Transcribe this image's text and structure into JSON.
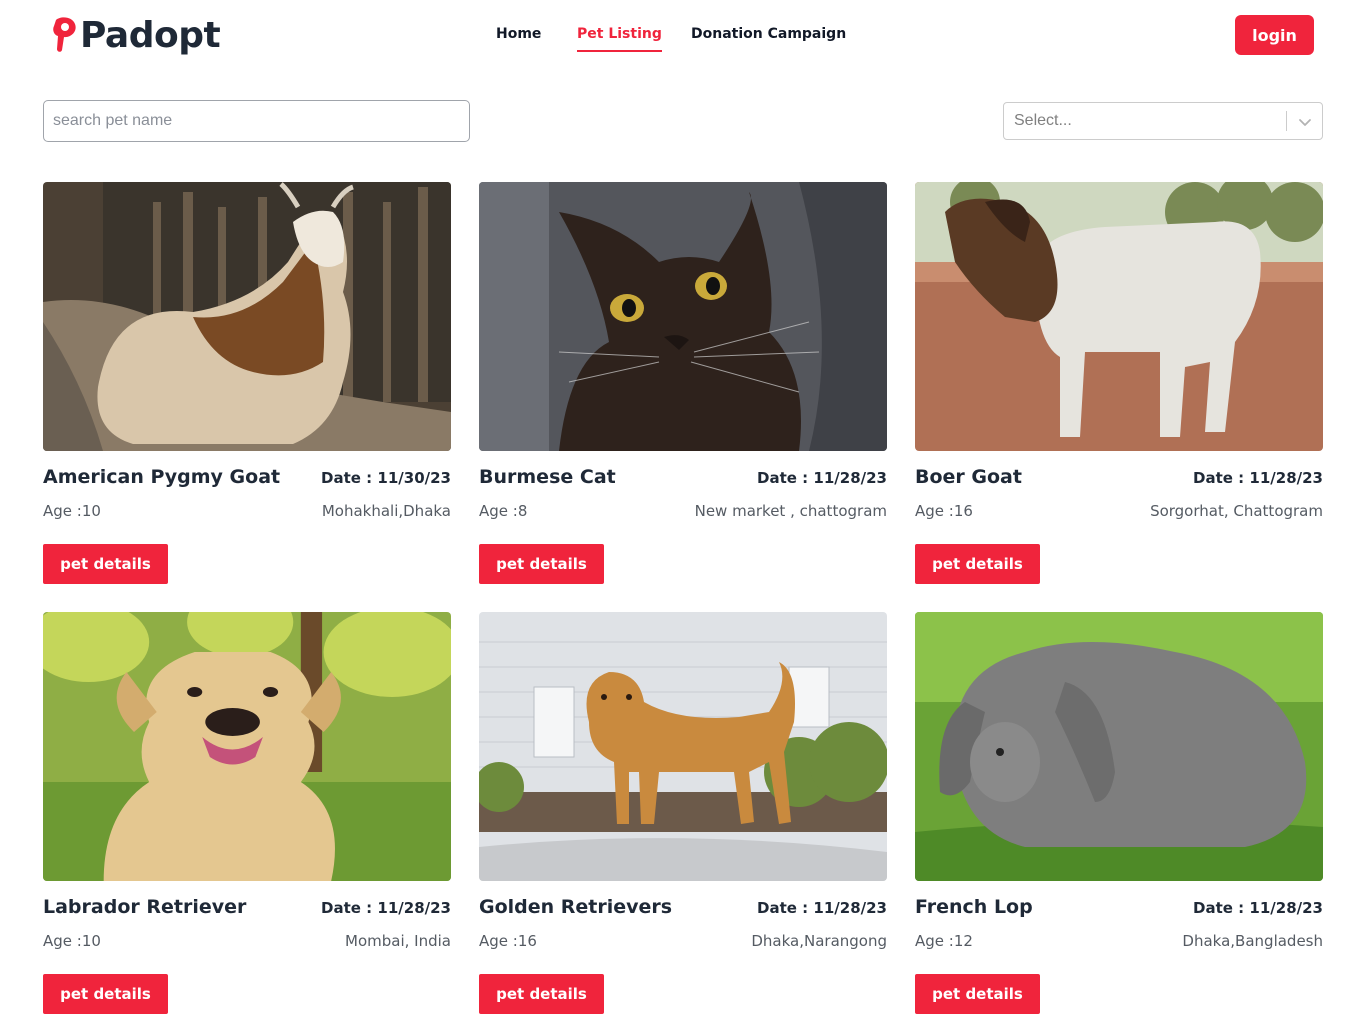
{
  "brand": {
    "name": "Padopt",
    "logo_icon": "paw-logo-icon",
    "accent": "#f0243c"
  },
  "nav": {
    "items": [
      {
        "label": "Home",
        "active": false
      },
      {
        "label": "Pet Listing",
        "active": true
      },
      {
        "label": "Donation Campaign",
        "active": false
      }
    ],
    "login_label": "login"
  },
  "filters": {
    "search_placeholder": "search pet name",
    "category_placeholder": "Select...",
    "category_icon": "chevron-down-icon"
  },
  "pets": [
    {
      "name": "American Pygmy Goat",
      "date": "Date : 11/30/23",
      "age": "Age :10",
      "location": "Mohakhali,Dhaka",
      "button": "pet details",
      "image": "goat-photo"
    },
    {
      "name": "Burmese Cat",
      "date": "Date : 11/28/23",
      "age": "Age :8",
      "location": "New market , chattogram",
      "button": "pet details",
      "image": "cat-photo"
    },
    {
      "name": "Boer Goat",
      "date": "Date : 11/28/23",
      "age": "Age :16",
      "location": "Sorgorhat, Chattogram",
      "button": "pet details",
      "image": "goat-photo"
    },
    {
      "name": "Labrador Retriever",
      "date": "Date : 11/28/23",
      "age": "Age :10",
      "location": "Mombai, India",
      "button": "pet details",
      "image": "dog-photo"
    },
    {
      "name": "Golden Retrievers",
      "date": "Date : 11/28/23",
      "age": "Age :16",
      "location": "Dhaka,Narangong",
      "button": "pet details",
      "image": "dog-photo"
    },
    {
      "name": "French Lop",
      "date": "Date : 11/28/23",
      "age": "Age :12",
      "location": "Dhaka,Bangladesh",
      "button": "pet details",
      "image": "rabbit-photo"
    }
  ]
}
